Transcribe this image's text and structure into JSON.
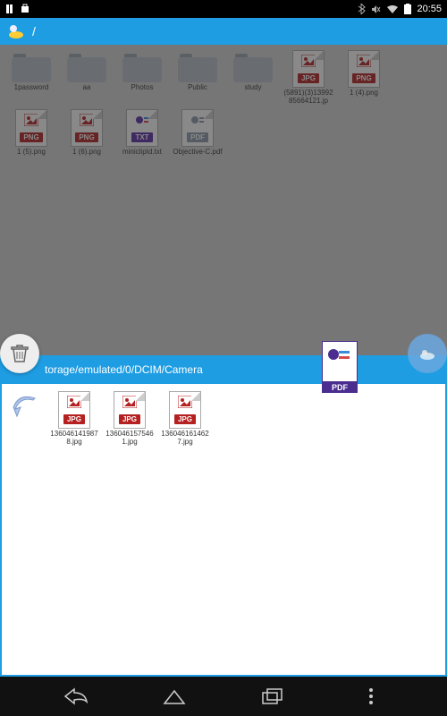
{
  "statusbar": {
    "time": "20:55"
  },
  "header": {
    "path": "/"
  },
  "top_grid": [
    {
      "type": "folder",
      "name": "1password"
    },
    {
      "type": "folder",
      "name": "aa"
    },
    {
      "type": "folder",
      "name": "Photos"
    },
    {
      "type": "folder",
      "name": "Public"
    },
    {
      "type": "folder",
      "name": "study"
    },
    {
      "type": "jpg",
      "name": "(5891)(3)1399285664121.jp"
    },
    {
      "type": "png",
      "name": "1 (4).png"
    },
    {
      "type": "png",
      "name": "1 (5).png"
    },
    {
      "type": "png",
      "name": "1 (6).png"
    },
    {
      "type": "txt",
      "name": "miniclipId.txt"
    },
    {
      "type": "pdf",
      "name": "Objective-C.pdf"
    }
  ],
  "badge": {
    "jpg": "JPG",
    "png": "PNG",
    "txt": "TXT",
    "pdf": "PDF"
  },
  "lower_header": {
    "path": "torage/emulated/0/DCIM/Camera"
  },
  "bottom_grid": [
    {
      "type": "jpg",
      "name": "1360461419878.jpg"
    },
    {
      "type": "jpg",
      "name": "1360461575461.jpg"
    },
    {
      "type": "jpg",
      "name": "1360461614627.jpg"
    }
  ],
  "float_pdf_label": "PDF"
}
